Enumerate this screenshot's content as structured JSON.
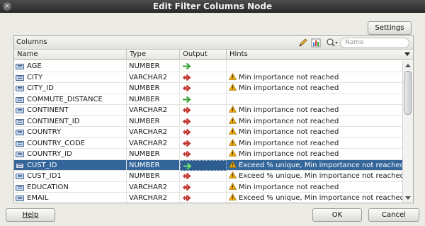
{
  "window": {
    "title": "Edit Filter Columns Node"
  },
  "toolbar": {
    "settings_label": "Settings"
  },
  "panel": {
    "label": "Columns",
    "search_placeholder": "Name",
    "icons": [
      "pencil-icon",
      "statistics-icon",
      "search-icon"
    ]
  },
  "table": {
    "headers": {
      "name": "Name",
      "type": "Type",
      "output": "Output",
      "hints": "Hints"
    },
    "rows": [
      {
        "name": "AGE",
        "type": "NUMBER",
        "output": "pass",
        "hint": ""
      },
      {
        "name": "CITY",
        "type": "VARCHAR2",
        "output": "ignore",
        "hint": "Min importance not reached"
      },
      {
        "name": "CITY_ID",
        "type": "NUMBER",
        "output": "ignore",
        "hint": "Min importance not reached"
      },
      {
        "name": "COMMUTE_DISTANCE",
        "type": "NUMBER",
        "output": "pass",
        "hint": ""
      },
      {
        "name": "CONTINENT",
        "type": "VARCHAR2",
        "output": "ignore",
        "hint": "Min importance not reached"
      },
      {
        "name": "CONTINENT_ID",
        "type": "NUMBER",
        "output": "ignore",
        "hint": "Min importance not reached"
      },
      {
        "name": "COUNTRY",
        "type": "VARCHAR2",
        "output": "ignore",
        "hint": "Min importance not reached"
      },
      {
        "name": "COUNTRY_CODE",
        "type": "VARCHAR2",
        "output": "ignore",
        "hint": "Min importance not reached"
      },
      {
        "name": "COUNTRY_ID",
        "type": "NUMBER",
        "output": "ignore",
        "hint": "Min importance not reached"
      },
      {
        "name": "CUST_ID",
        "type": "NUMBER",
        "output": "pass",
        "hint": "Exceed % unique, Min importance not reached",
        "selected": true
      },
      {
        "name": "CUST_ID1",
        "type": "NUMBER",
        "output": "ignore",
        "hint": "Exceed % unique, Min importance not reached"
      },
      {
        "name": "EDUCATION",
        "type": "VARCHAR2",
        "output": "ignore",
        "hint": "Min importance not reached"
      },
      {
        "name": "EMAIL",
        "type": "VARCHAR2",
        "output": "ignore",
        "hint": "Exceed % unique, Min importance not reached"
      }
    ]
  },
  "footer": {
    "help_label": "Help",
    "ok_label": "OK",
    "cancel_label": "Cancel"
  },
  "colors": {
    "selected_row": "#35669a",
    "pass_arrow": "#2e9e2e",
    "ignore_arrow": "#c0342c",
    "warning": "#f2a800"
  }
}
